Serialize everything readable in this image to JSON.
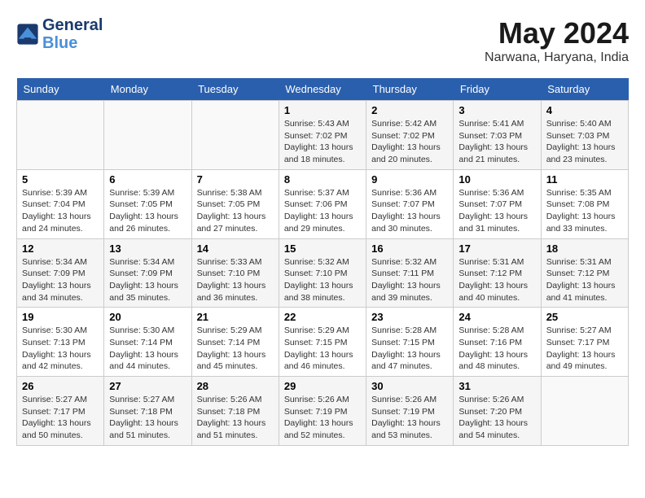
{
  "header": {
    "logo_line1": "General",
    "logo_line2": "Blue",
    "month_year": "May 2024",
    "location": "Narwana, Haryana, India"
  },
  "days_of_week": [
    "Sunday",
    "Monday",
    "Tuesday",
    "Wednesday",
    "Thursday",
    "Friday",
    "Saturday"
  ],
  "weeks": [
    [
      {
        "day": "",
        "info": ""
      },
      {
        "day": "",
        "info": ""
      },
      {
        "day": "",
        "info": ""
      },
      {
        "day": "1",
        "info": "Sunrise: 5:43 AM\nSunset: 7:02 PM\nDaylight: 13 hours\nand 18 minutes."
      },
      {
        "day": "2",
        "info": "Sunrise: 5:42 AM\nSunset: 7:02 PM\nDaylight: 13 hours\nand 20 minutes."
      },
      {
        "day": "3",
        "info": "Sunrise: 5:41 AM\nSunset: 7:03 PM\nDaylight: 13 hours\nand 21 minutes."
      },
      {
        "day": "4",
        "info": "Sunrise: 5:40 AM\nSunset: 7:03 PM\nDaylight: 13 hours\nand 23 minutes."
      }
    ],
    [
      {
        "day": "5",
        "info": "Sunrise: 5:39 AM\nSunset: 7:04 PM\nDaylight: 13 hours\nand 24 minutes."
      },
      {
        "day": "6",
        "info": "Sunrise: 5:39 AM\nSunset: 7:05 PM\nDaylight: 13 hours\nand 26 minutes."
      },
      {
        "day": "7",
        "info": "Sunrise: 5:38 AM\nSunset: 7:05 PM\nDaylight: 13 hours\nand 27 minutes."
      },
      {
        "day": "8",
        "info": "Sunrise: 5:37 AM\nSunset: 7:06 PM\nDaylight: 13 hours\nand 29 minutes."
      },
      {
        "day": "9",
        "info": "Sunrise: 5:36 AM\nSunset: 7:07 PM\nDaylight: 13 hours\nand 30 minutes."
      },
      {
        "day": "10",
        "info": "Sunrise: 5:36 AM\nSunset: 7:07 PM\nDaylight: 13 hours\nand 31 minutes."
      },
      {
        "day": "11",
        "info": "Sunrise: 5:35 AM\nSunset: 7:08 PM\nDaylight: 13 hours\nand 33 minutes."
      }
    ],
    [
      {
        "day": "12",
        "info": "Sunrise: 5:34 AM\nSunset: 7:09 PM\nDaylight: 13 hours\nand 34 minutes."
      },
      {
        "day": "13",
        "info": "Sunrise: 5:34 AM\nSunset: 7:09 PM\nDaylight: 13 hours\nand 35 minutes."
      },
      {
        "day": "14",
        "info": "Sunrise: 5:33 AM\nSunset: 7:10 PM\nDaylight: 13 hours\nand 36 minutes."
      },
      {
        "day": "15",
        "info": "Sunrise: 5:32 AM\nSunset: 7:10 PM\nDaylight: 13 hours\nand 38 minutes."
      },
      {
        "day": "16",
        "info": "Sunrise: 5:32 AM\nSunset: 7:11 PM\nDaylight: 13 hours\nand 39 minutes."
      },
      {
        "day": "17",
        "info": "Sunrise: 5:31 AM\nSunset: 7:12 PM\nDaylight: 13 hours\nand 40 minutes."
      },
      {
        "day": "18",
        "info": "Sunrise: 5:31 AM\nSunset: 7:12 PM\nDaylight: 13 hours\nand 41 minutes."
      }
    ],
    [
      {
        "day": "19",
        "info": "Sunrise: 5:30 AM\nSunset: 7:13 PM\nDaylight: 13 hours\nand 42 minutes."
      },
      {
        "day": "20",
        "info": "Sunrise: 5:30 AM\nSunset: 7:14 PM\nDaylight: 13 hours\nand 44 minutes."
      },
      {
        "day": "21",
        "info": "Sunrise: 5:29 AM\nSunset: 7:14 PM\nDaylight: 13 hours\nand 45 minutes."
      },
      {
        "day": "22",
        "info": "Sunrise: 5:29 AM\nSunset: 7:15 PM\nDaylight: 13 hours\nand 46 minutes."
      },
      {
        "day": "23",
        "info": "Sunrise: 5:28 AM\nSunset: 7:15 PM\nDaylight: 13 hours\nand 47 minutes."
      },
      {
        "day": "24",
        "info": "Sunrise: 5:28 AM\nSunset: 7:16 PM\nDaylight: 13 hours\nand 48 minutes."
      },
      {
        "day": "25",
        "info": "Sunrise: 5:27 AM\nSunset: 7:17 PM\nDaylight: 13 hours\nand 49 minutes."
      }
    ],
    [
      {
        "day": "26",
        "info": "Sunrise: 5:27 AM\nSunset: 7:17 PM\nDaylight: 13 hours\nand 50 minutes."
      },
      {
        "day": "27",
        "info": "Sunrise: 5:27 AM\nSunset: 7:18 PM\nDaylight: 13 hours\nand 51 minutes."
      },
      {
        "day": "28",
        "info": "Sunrise: 5:26 AM\nSunset: 7:18 PM\nDaylight: 13 hours\nand 51 minutes."
      },
      {
        "day": "29",
        "info": "Sunrise: 5:26 AM\nSunset: 7:19 PM\nDaylight: 13 hours\nand 52 minutes."
      },
      {
        "day": "30",
        "info": "Sunrise: 5:26 AM\nSunset: 7:19 PM\nDaylight: 13 hours\nand 53 minutes."
      },
      {
        "day": "31",
        "info": "Sunrise: 5:26 AM\nSunset: 7:20 PM\nDaylight: 13 hours\nand 54 minutes."
      },
      {
        "day": "",
        "info": ""
      }
    ]
  ]
}
